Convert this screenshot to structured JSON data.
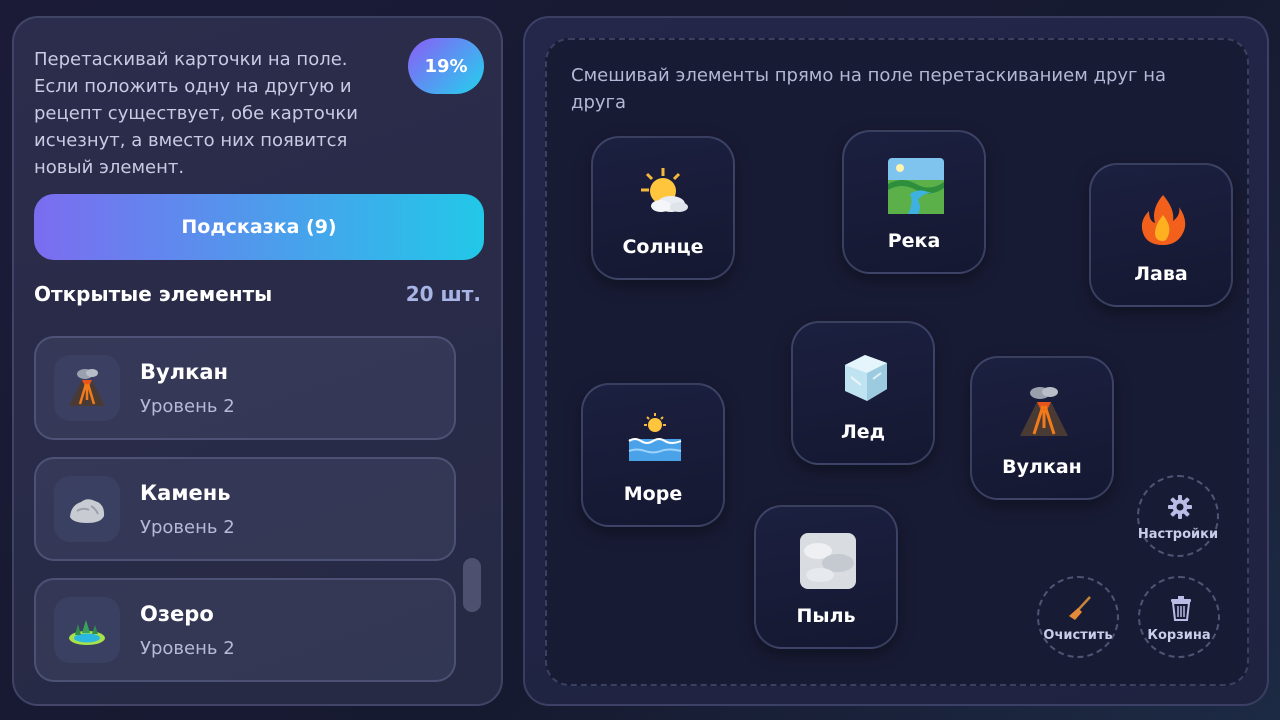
{
  "sidebar": {
    "instruction": "Перетаскивай карточки на поле. Если положить одну на другую и рецепт существует, обе карточки исчезнут, а вместо них появится новый элемент.",
    "progress": "19%",
    "hint_button": "Подсказка (9)",
    "section_title": "Открытые элементы",
    "section_count": "20 шт.",
    "items": [
      {
        "name": "Вулкан",
        "level": "Уровень 2",
        "icon": "volcano-icon"
      },
      {
        "name": "Камень",
        "level": "Уровень 2",
        "icon": "rock-icon"
      },
      {
        "name": "Озеро",
        "level": "Уровень 2",
        "icon": "lake-icon"
      }
    ]
  },
  "board": {
    "hint": "Смешивай элементы прямо на поле перетаскиванием друг на друга",
    "cards": [
      {
        "label": "Солнце",
        "icon": "sun-cloud-icon"
      },
      {
        "label": "Река",
        "icon": "river-icon"
      },
      {
        "label": "Лава",
        "icon": "fire-icon"
      },
      {
        "label": "Лед",
        "icon": "ice-icon"
      },
      {
        "label": "Вулкан",
        "icon": "volcano-icon"
      },
      {
        "label": "Море",
        "icon": "sea-icon"
      },
      {
        "label": "Пыль",
        "icon": "dust-icon"
      }
    ]
  },
  "tools": {
    "settings": "Настройки",
    "clear": "Очистить",
    "trash": "Корзина"
  },
  "colors": {
    "accent_start": "#7c6cf0",
    "accent_end": "#22c8e8"
  }
}
